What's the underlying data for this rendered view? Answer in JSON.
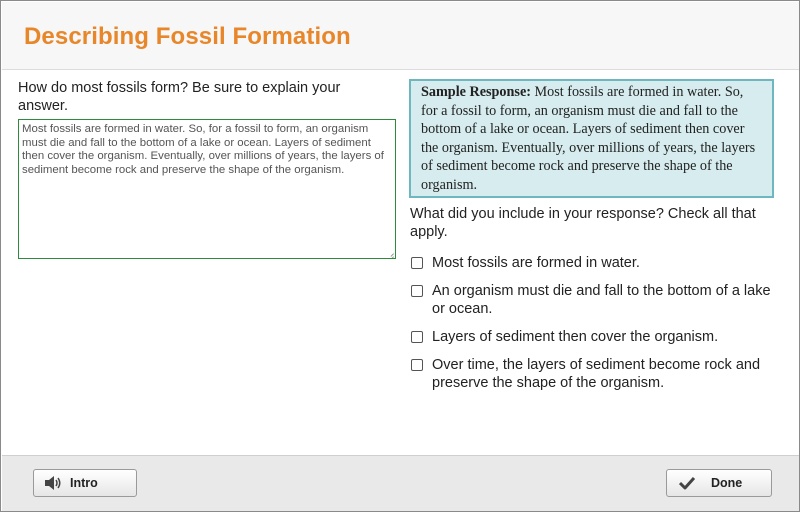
{
  "header": {
    "title": "Describing Fossil Formation"
  },
  "question": {
    "prompt": "How do most fossils form? Be sure to explain your answer.",
    "answer_value": "Most fossils are formed in water. So, for a fossil to form, an organism must die and fall to the bottom of a lake or ocean. Layers of sediment then cover the organism. Eventually, over millions of years, the layers of sediment become rock and preserve the shape of the organism."
  },
  "sample": {
    "label": "Sample Response:",
    "text": "Most fossils are formed in water. So, for a fossil to form, an organism must die and fall to the bottom of a lake or ocean. Layers of sediment then cover the organism. Eventually, over millions of years, the layers of sediment become rock and preserve the shape of the organism."
  },
  "checklist": {
    "prompt": "What did you include in your response? Check all that apply.",
    "options": [
      {
        "label": "Most fossils are formed in water.",
        "checked": false
      },
      {
        "label": "An organism must die and fall to the bottom of a lake or ocean.",
        "checked": false
      },
      {
        "label": "Layers of sediment then cover the organism.",
        "checked": false
      },
      {
        "label": "Over time, the layers of sediment become rock and preserve the shape of the organism.",
        "checked": false
      }
    ]
  },
  "footer": {
    "intro_label": "Intro",
    "intro_icon": "speaker-icon",
    "done_label": "Done",
    "done_icon": "checkmark-icon"
  },
  "colors": {
    "title": "#e8862a",
    "answer_border": "#2e8b3a",
    "sample_bg": "#d6ecee",
    "sample_border": "#6fb7bf"
  }
}
